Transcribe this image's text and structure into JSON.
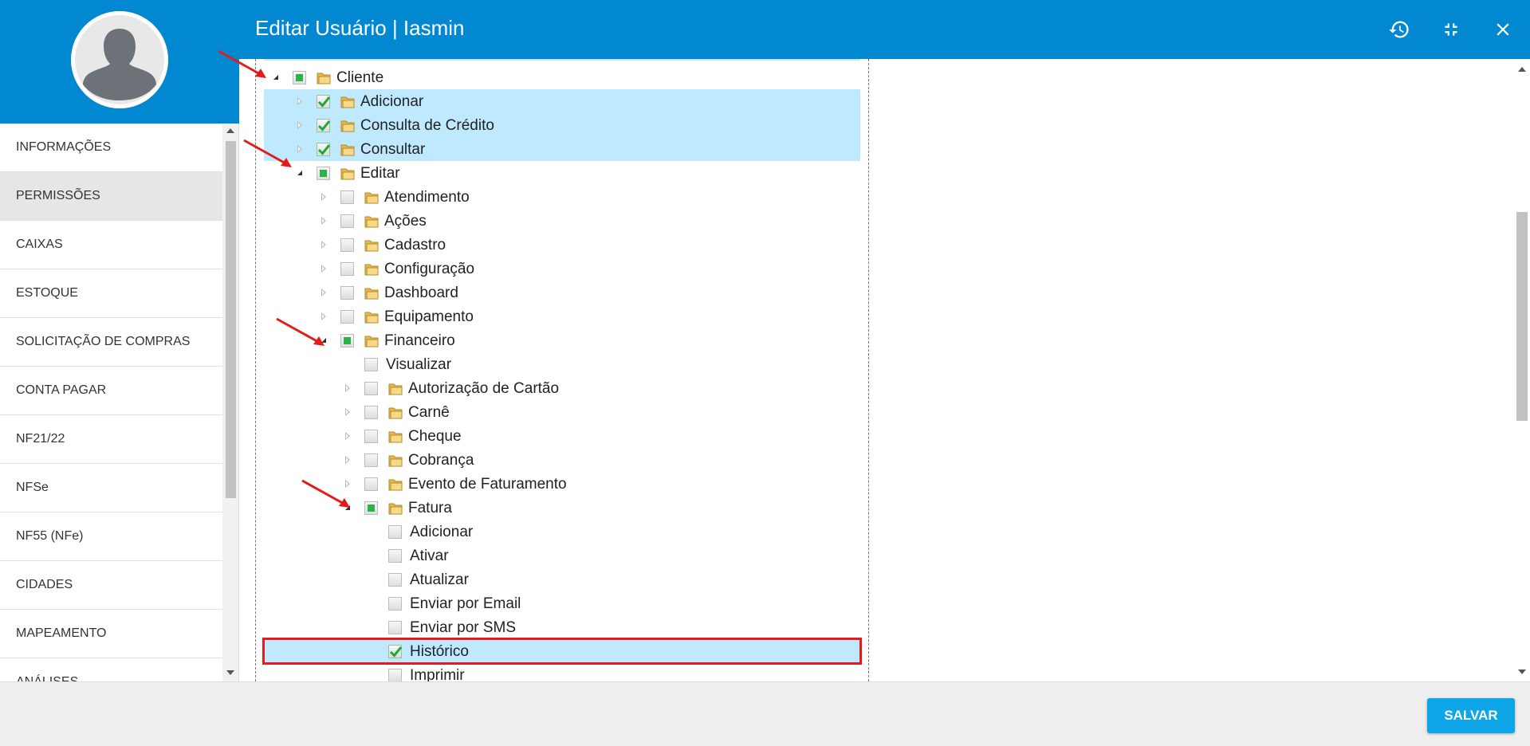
{
  "header": {
    "title": "Editar Usuário | Iasmin",
    "history_icon": "history-icon",
    "minimize_icon": "compress-icon",
    "close_icon": "close-icon"
  },
  "sidebar": {
    "items": [
      {
        "label": "INFORMAÇÕES",
        "active": false
      },
      {
        "label": "PERMISSÕES",
        "active": true
      },
      {
        "label": "CAIXAS",
        "active": false
      },
      {
        "label": "ESTOQUE",
        "active": false
      },
      {
        "label": "SOLICITAÇÃO DE COMPRAS",
        "active": false
      },
      {
        "label": "CONTA PAGAR",
        "active": false
      },
      {
        "label": "NF21/22",
        "active": false
      },
      {
        "label": "NFSe",
        "active": false
      },
      {
        "label": "NF55 (NFe)",
        "active": false
      },
      {
        "label": "CIDADES",
        "active": false
      },
      {
        "label": "MAPEAMENTO",
        "active": false
      },
      {
        "label": "ANÁLISES",
        "active": false
      }
    ]
  },
  "tree": {
    "rows": [
      {
        "label": "Cliente",
        "level": 0,
        "expander": "expanded",
        "check": "partial",
        "folder": true,
        "highlight": false
      },
      {
        "label": "Adicionar",
        "level": 1,
        "expander": "collapsed",
        "check": "checked",
        "folder": true,
        "highlight": true
      },
      {
        "label": "Consulta de Crédito",
        "level": 1,
        "expander": "collapsed",
        "check": "checked",
        "folder": true,
        "highlight": true
      },
      {
        "label": "Consultar",
        "level": 1,
        "expander": "collapsed",
        "check": "checked",
        "folder": true,
        "highlight": true
      },
      {
        "label": "Editar",
        "level": 1,
        "expander": "expanded",
        "check": "partial",
        "folder": true,
        "highlight": false
      },
      {
        "label": "Atendimento",
        "level": 2,
        "expander": "collapsed",
        "check": "none",
        "folder": true,
        "highlight": false
      },
      {
        "label": "Ações",
        "level": 2,
        "expander": "collapsed",
        "check": "none",
        "folder": true,
        "highlight": false
      },
      {
        "label": "Cadastro",
        "level": 2,
        "expander": "collapsed",
        "check": "none",
        "folder": true,
        "highlight": false
      },
      {
        "label": "Configuração",
        "level": 2,
        "expander": "collapsed",
        "check": "none",
        "folder": true,
        "highlight": false
      },
      {
        "label": "Dashboard",
        "level": 2,
        "expander": "collapsed",
        "check": "none",
        "folder": true,
        "highlight": false
      },
      {
        "label": "Equipamento",
        "level": 2,
        "expander": "collapsed",
        "check": "none",
        "folder": true,
        "highlight": false
      },
      {
        "label": "Financeiro",
        "level": 2,
        "expander": "expanded",
        "check": "partial",
        "folder": true,
        "highlight": false
      },
      {
        "label": "Visualizar",
        "level": 3,
        "expander": "none",
        "check": "none",
        "folder": false,
        "highlight": false
      },
      {
        "label": "Autorização de Cartão",
        "level": 3,
        "expander": "collapsed",
        "check": "none",
        "folder": true,
        "highlight": false
      },
      {
        "label": "Carnê",
        "level": 3,
        "expander": "collapsed",
        "check": "none",
        "folder": true,
        "highlight": false
      },
      {
        "label": "Cheque",
        "level": 3,
        "expander": "collapsed",
        "check": "none",
        "folder": true,
        "highlight": false
      },
      {
        "label": "Cobrança",
        "level": 3,
        "expander": "collapsed",
        "check": "none",
        "folder": true,
        "highlight": false
      },
      {
        "label": "Evento de Faturamento",
        "level": 3,
        "expander": "collapsed",
        "check": "none",
        "folder": true,
        "highlight": false
      },
      {
        "label": "Fatura",
        "level": 3,
        "expander": "expanded",
        "check": "partial",
        "folder": true,
        "highlight": false
      },
      {
        "label": "Adicionar",
        "level": 4,
        "expander": "none",
        "check": "none",
        "folder": false,
        "highlight": false
      },
      {
        "label": "Ativar",
        "level": 4,
        "expander": "none",
        "check": "none",
        "folder": false,
        "highlight": false
      },
      {
        "label": "Atualizar",
        "level": 4,
        "expander": "none",
        "check": "none",
        "folder": false,
        "highlight": false
      },
      {
        "label": "Enviar por Email",
        "level": 4,
        "expander": "none",
        "check": "none",
        "folder": false,
        "highlight": false
      },
      {
        "label": "Enviar por SMS",
        "level": 4,
        "expander": "none",
        "check": "none",
        "folder": false,
        "highlight": false
      },
      {
        "label": "Histórico",
        "level": 4,
        "expander": "none",
        "check": "checked",
        "folder": false,
        "highlight": true,
        "boxed": true
      },
      {
        "label": "Imprimir",
        "level": 4,
        "expander": "none",
        "check": "none",
        "folder": false,
        "highlight": false
      }
    ]
  },
  "footer": {
    "save_label": "SALVAR"
  },
  "colors": {
    "brand": "#0288d1",
    "save_button": "#0ea5e9",
    "highlight_row": "#bfe9fe",
    "annotation_red": "#e51b1b"
  }
}
